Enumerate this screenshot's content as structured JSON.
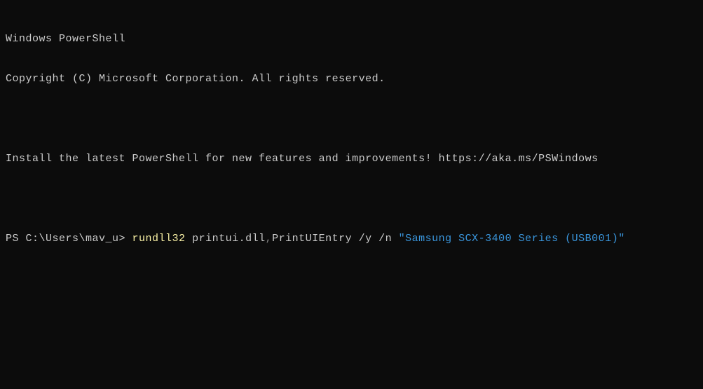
{
  "header": {
    "line1": "Windows PowerShell",
    "line2": "Copyright (C) Microsoft Corporation. All rights reserved.",
    "line3": "Install the latest PowerShell for new features and improvements! https://aka.ms/PSWindows"
  },
  "prompt": {
    "prefix": "PS C:\\Users\\mav_u>",
    "cmd_token1": "rundll32",
    "cmd_token2": " printui.dll",
    "cmd_comma": ",",
    "cmd_token3": "PrintUIEntry /y /n ",
    "cmd_string": "\"Samsung SCX-3400 Series (USB001)\""
  }
}
